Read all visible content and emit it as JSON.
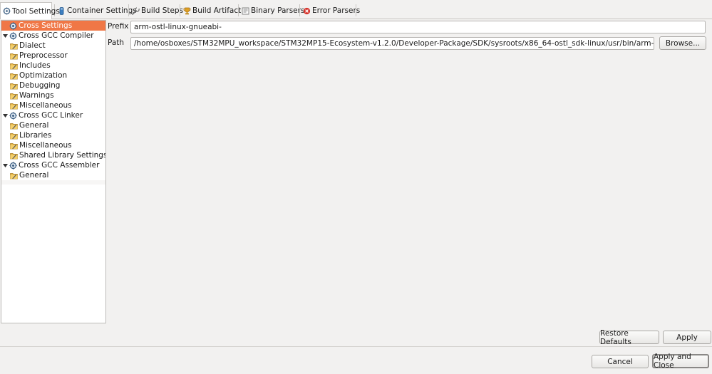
{
  "tabs": [
    {
      "label": "Tool Settings",
      "icon": "tool-settings-icon",
      "active": true
    },
    {
      "label": "Container Settings",
      "icon": "container-icon",
      "active": false
    },
    {
      "label": "Build Steps",
      "icon": "wrench-icon",
      "active": false
    },
    {
      "label": "Build Artifact",
      "icon": "trophy-icon",
      "active": false
    },
    {
      "label": "Binary Parsers",
      "icon": "binary-parsers-icon",
      "active": false
    },
    {
      "label": "Error Parsers",
      "icon": "error-icon",
      "active": false
    }
  ],
  "tree": {
    "items": [
      {
        "label": "Cross Settings",
        "icon": "tool-icon",
        "level": 0,
        "twisty": false,
        "selected": true
      },
      {
        "label": "Cross GCC Compiler",
        "icon": "tool-icon",
        "level": 0,
        "twisty": true,
        "selected": false
      },
      {
        "label": "Dialect",
        "icon": "option-category-icon",
        "level": 1,
        "twisty": false,
        "selected": false
      },
      {
        "label": "Preprocessor",
        "icon": "option-category-icon",
        "level": 1,
        "twisty": false,
        "selected": false
      },
      {
        "label": "Includes",
        "icon": "option-category-icon",
        "level": 1,
        "twisty": false,
        "selected": false
      },
      {
        "label": "Optimization",
        "icon": "option-category-icon",
        "level": 1,
        "twisty": false,
        "selected": false
      },
      {
        "label": "Debugging",
        "icon": "option-category-icon",
        "level": 1,
        "twisty": false,
        "selected": false
      },
      {
        "label": "Warnings",
        "icon": "option-category-icon",
        "level": 1,
        "twisty": false,
        "selected": false
      },
      {
        "label": "Miscellaneous",
        "icon": "option-category-icon",
        "level": 1,
        "twisty": false,
        "selected": false
      },
      {
        "label": "Cross GCC Linker",
        "icon": "tool-icon",
        "level": 0,
        "twisty": true,
        "selected": false
      },
      {
        "label": "General",
        "icon": "option-category-icon",
        "level": 1,
        "twisty": false,
        "selected": false
      },
      {
        "label": "Libraries",
        "icon": "option-category-icon",
        "level": 1,
        "twisty": false,
        "selected": false
      },
      {
        "label": "Miscellaneous",
        "icon": "option-category-icon",
        "level": 1,
        "twisty": false,
        "selected": false
      },
      {
        "label": "Shared Library Settings",
        "icon": "option-category-icon",
        "level": 1,
        "twisty": false,
        "selected": false
      },
      {
        "label": "Cross GCC Assembler",
        "icon": "tool-icon",
        "level": 0,
        "twisty": true,
        "selected": false
      },
      {
        "label": "General",
        "icon": "option-category-icon",
        "level": 1,
        "twisty": false,
        "selected": false
      }
    ]
  },
  "settings": {
    "prefix_label": "Prefix",
    "prefix_value": "arm-ostl-linux-gnueabi-",
    "path_label": "Path",
    "path_value": "/home/osboxes/STM32MPU_workspace/STM32MP15-Ecosystem-v1.2.0/Developer-Package/SDK/sysroots/x86_64-ostl_sdk-linux/usr/bin/arm-ostl-linux-gnueabi/",
    "browse_label": "Browse..."
  },
  "buttons": {
    "restore_defaults": "Restore Defaults",
    "apply": "Apply",
    "cancel": "Cancel",
    "apply_and_close": "Apply and Close"
  },
  "colors": {
    "selection": "#f07746",
    "background": "#f2f1f0"
  }
}
